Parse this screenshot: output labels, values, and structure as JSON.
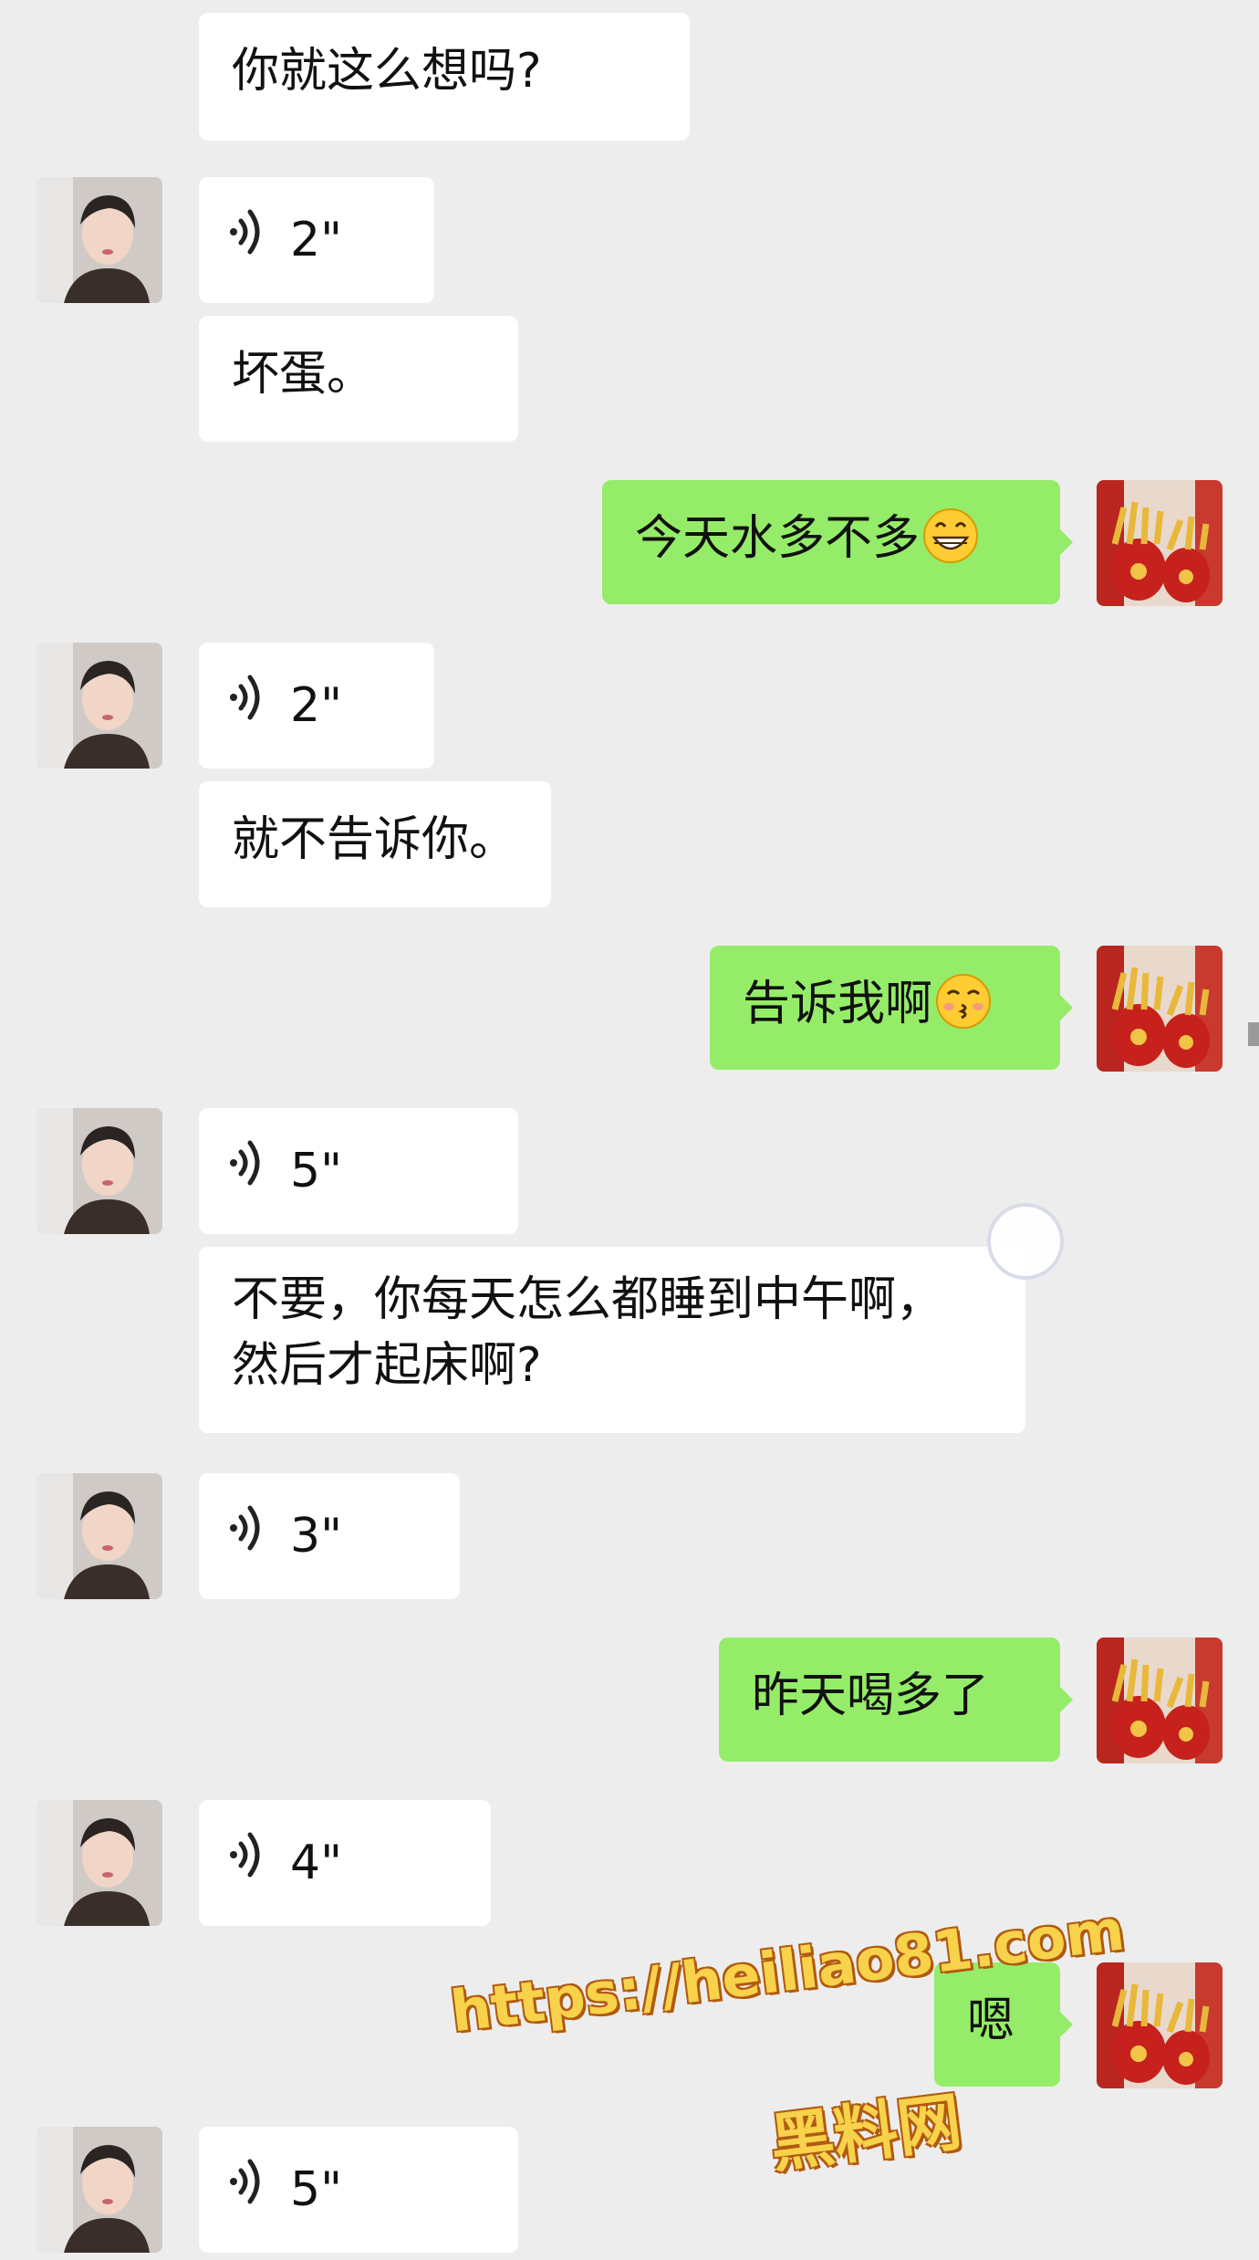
{
  "messages": [
    {
      "side": "left",
      "type": "text",
      "text": "你就这么想吗?"
    },
    {
      "side": "left",
      "type": "voice",
      "duration": "2\""
    },
    {
      "side": "left",
      "type": "text",
      "text": "坏蛋。"
    },
    {
      "side": "right",
      "type": "text",
      "text": "今天水多不多",
      "emoji": "grinning-face-emoji"
    },
    {
      "side": "left",
      "type": "voice",
      "duration": "2\""
    },
    {
      "side": "left",
      "type": "text",
      "text": "就不告诉你。"
    },
    {
      "side": "right",
      "type": "text",
      "text": "告诉我啊",
      "emoji": "kissing-face-emoji"
    },
    {
      "side": "left",
      "type": "voice",
      "duration": "5\""
    },
    {
      "side": "left",
      "type": "text",
      "lines": [
        "不要，你每天怎么都睡到中午啊，",
        "然后才起床啊?"
      ]
    },
    {
      "side": "left",
      "type": "voice",
      "duration": "3\""
    },
    {
      "side": "right",
      "type": "text",
      "text": "昨天喝多了"
    },
    {
      "side": "left",
      "type": "voice",
      "duration": "4\""
    },
    {
      "side": "right",
      "type": "text",
      "text": "嗯"
    },
    {
      "side": "left",
      "type": "voice",
      "duration": "5\""
    }
  ],
  "watermark": {
    "line1": "https://heiliao81.com",
    "line2": "黑料网"
  },
  "colors": {
    "background": "#ededed",
    "left_bubble": "#ffffff",
    "right_bubble": "#95ec69",
    "watermark": "#f7d24a"
  }
}
